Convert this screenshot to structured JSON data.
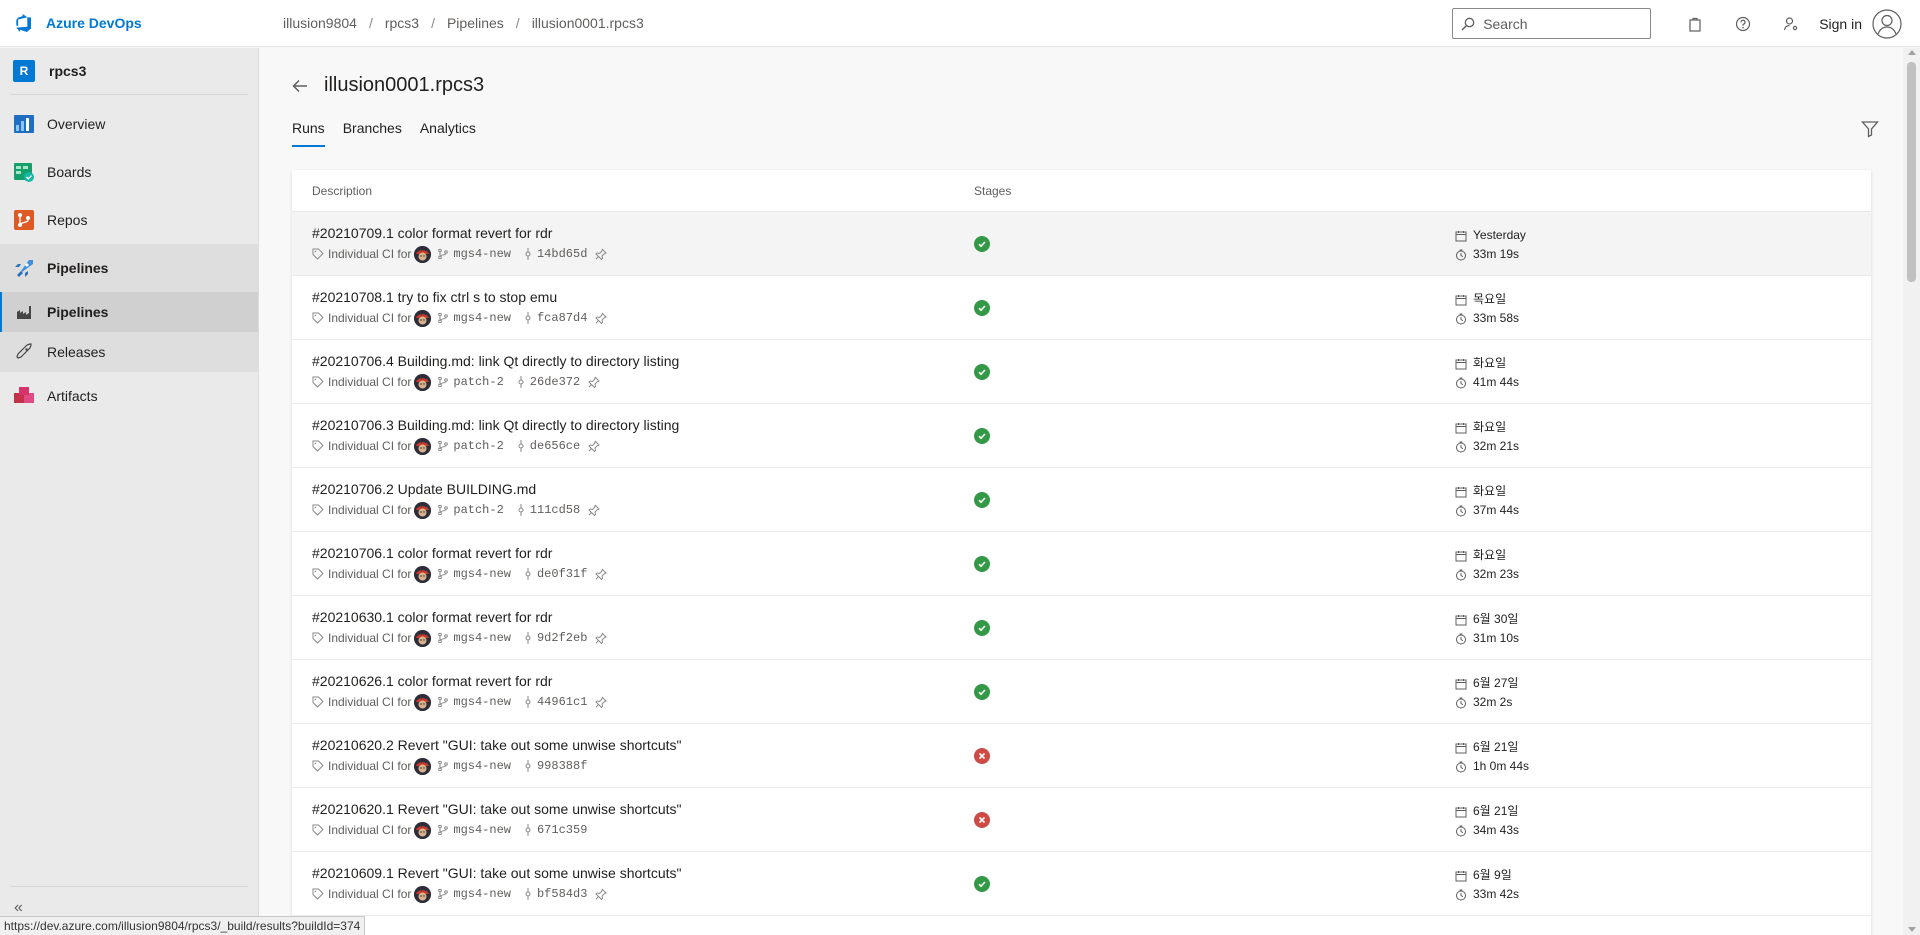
{
  "app": {
    "name": "Azure DevOps"
  },
  "breadcrumb": [
    "illusion9804",
    "rpcs3",
    "Pipelines",
    "illusion0001.rpcs3"
  ],
  "breadcrumb_separator": "/",
  "search": {
    "placeholder": "Search"
  },
  "signin": {
    "label": "Sign in"
  },
  "sidebar": {
    "project_initial": "R",
    "project_name": "rpcs3",
    "items": [
      {
        "label": "Overview",
        "icon": "overview-icon"
      },
      {
        "label": "Boards",
        "icon": "boards-icon"
      },
      {
        "label": "Repos",
        "icon": "repos-icon"
      },
      {
        "label": "Pipelines",
        "icon": "pipelines-icon"
      }
    ],
    "subitems": [
      {
        "label": "Pipelines",
        "icon": "pipelines-sub-icon"
      },
      {
        "label": "Releases",
        "icon": "releases-icon"
      }
    ],
    "artifacts": {
      "label": "Artifacts",
      "icon": "artifacts-icon"
    },
    "collapse": "«"
  },
  "page": {
    "title": "illusion0001.rpcs3",
    "tabs": [
      "Runs",
      "Branches",
      "Analytics"
    ]
  },
  "table": {
    "col_description": "Description",
    "col_stages": "Stages"
  },
  "runs": [
    {
      "title": "#20210709.1 color format revert for rdr",
      "trigger": "Individual CI for",
      "branch": "mgs4-new",
      "commit": "14bd65d",
      "pinned": true,
      "status": "succeeded",
      "date": "Yesterday",
      "duration": "33m 19s"
    },
    {
      "title": "#20210708.1 try to fix ctrl s to stop emu",
      "trigger": "Individual CI for",
      "branch": "mgs4-new",
      "commit": "fca87d4",
      "pinned": true,
      "status": "succeeded",
      "date": "목요일",
      "duration": "33m 58s"
    },
    {
      "title": "#20210706.4 Building.md: link Qt directly to directory listing",
      "trigger": "Individual CI for",
      "branch": "patch-2",
      "commit": "26de372",
      "pinned": true,
      "status": "succeeded",
      "date": "화요일",
      "duration": "41m 44s"
    },
    {
      "title": "#20210706.3 Building.md: link Qt directly to directory listing",
      "trigger": "Individual CI for",
      "branch": "patch-2",
      "commit": "de656ce",
      "pinned": true,
      "status": "succeeded",
      "date": "화요일",
      "duration": "32m 21s"
    },
    {
      "title": "#20210706.2 Update BUILDING.md",
      "trigger": "Individual CI for",
      "branch": "patch-2",
      "commit": "111cd58",
      "pinned": true,
      "status": "succeeded",
      "date": "화요일",
      "duration": "37m 44s"
    },
    {
      "title": "#20210706.1 color format revert for rdr",
      "trigger": "Individual CI for",
      "branch": "mgs4-new",
      "commit": "de0f31f",
      "pinned": true,
      "status": "succeeded",
      "date": "화요일",
      "duration": "32m 23s"
    },
    {
      "title": "#20210630.1 color format revert for rdr",
      "trigger": "Individual CI for",
      "branch": "mgs4-new",
      "commit": "9d2f2eb",
      "pinned": true,
      "status": "succeeded",
      "date": "6월 30일",
      "duration": "31m 10s"
    },
    {
      "title": "#20210626.1 color format revert for rdr",
      "trigger": "Individual CI for",
      "branch": "mgs4-new",
      "commit": "44961c1",
      "pinned": true,
      "status": "succeeded",
      "date": "6월 27일",
      "duration": "32m 2s"
    },
    {
      "title": "#20210620.2 Revert \"GUI: take out some unwise shortcuts\"",
      "trigger": "Individual CI for",
      "branch": "mgs4-new",
      "commit": "998388f",
      "pinned": false,
      "status": "failed",
      "date": "6월 21일",
      "duration": "1h 0m 44s"
    },
    {
      "title": "#20210620.1 Revert \"GUI: take out some unwise shortcuts\"",
      "trigger": "Individual CI for",
      "branch": "mgs4-new",
      "commit": "671c359",
      "pinned": false,
      "status": "failed",
      "date": "6월 21일",
      "duration": "34m 43s"
    },
    {
      "title": "#20210609.1 Revert \"GUI: take out some unwise shortcuts\"",
      "trigger": "Individual CI for",
      "branch": "mgs4-new",
      "commit": "bf584d3",
      "pinned": true,
      "status": "succeeded",
      "date": "6월 9일",
      "duration": "33m 42s"
    }
  ],
  "status_bar": {
    "url": "https://dev.azure.com/illusion9804/rpcs3/_build/results?buildId=374"
  },
  "colors": {
    "accent": "#0078d4",
    "success": "#339947",
    "failure": "#cd4a45"
  }
}
